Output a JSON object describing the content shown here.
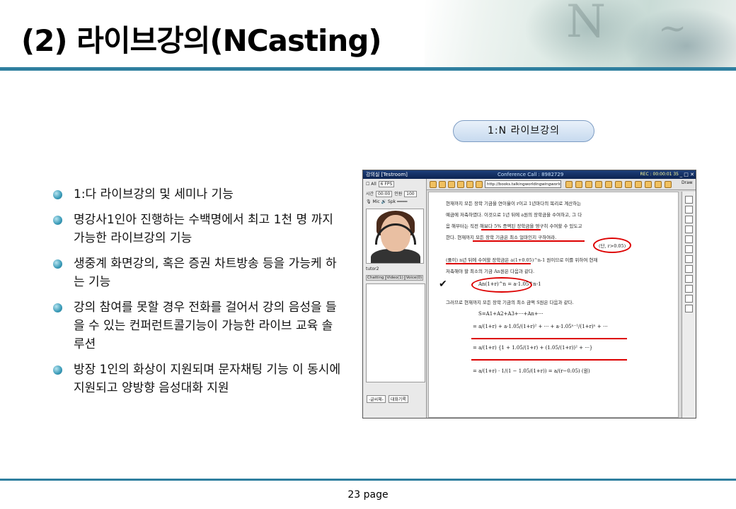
{
  "title": "(2) 라이브강의(NCasting)",
  "caption": "1:N 라이브강의",
  "bullets": [
    "1:다 라이브강의 및 세미나 기능",
    "명강사1인아 진행하는 수백명에서 최고 1천 명 까지 가능한 라이브강의 기능",
    "생중계 화면강의, 혹은 증권 차트방송 등을 가능케 하는 기능",
    "강의 참여를 못할 경우 전화를 걸어서 강의 음성을 들을 수 있는 컨퍼런트콜기능이 가능한 라이브 교육 솔루션",
    "방장 1인의 화상이 지원되며 문자채팅 기능 이 동시에 지원되고 양방향 음성대화 지원"
  ],
  "screenshot": {
    "window_title": "강의실 [Testroom]",
    "conference": "Conference Call : 8982729",
    "rec": "REC : 00:00:01 35",
    "fps": "6 FPS",
    "time_label": "시간",
    "time_value": "00:00",
    "people_label": "인원",
    "people_value": "100",
    "mic": "Mic",
    "spk": "Spk",
    "user": "tutor2",
    "tabs": [
      "Chatting",
      "Video(1)",
      "Voice(0)"
    ],
    "font_select": "-글씨체-",
    "chat_btn": "대화기록",
    "url": "http://books.talkingworldingwingworld.c",
    "draw": "Draw",
    "board_lines": [
      "현재까지 모든 장학 기금을 연이율이 r이고 1년마다의 복리로 계산하는",
      "예금에 저축하였다. 이것으로 1년 뒤에 a원의 장학금을 수여하고, 그 다",
      "음 해부터는 직전 해보다 5% 증액된 장학금을 영구히 수여할 수 있도고",
      "한다. 현재까지 모든 장학 기금은 최소 얼마인지 구하여라.",
      "(단, r>0.05)",
      "(풀이) n년 뒤에 수여할 장학금은 a(1+0.05)^n-1 원이므로 이를 위하여 현재",
      "저축해야 할 최소의 기금 An원은 다음과 같다.",
      "그러므로 현재까지 모든 장학 기금의 최소 금액 S원은 다음과 같다."
    ],
    "board_note": "An(1+r)^n = a·1.05^n-1",
    "board_sum": "S=A1+A2+A3+···+An+···"
  },
  "page_label": "23 page"
}
